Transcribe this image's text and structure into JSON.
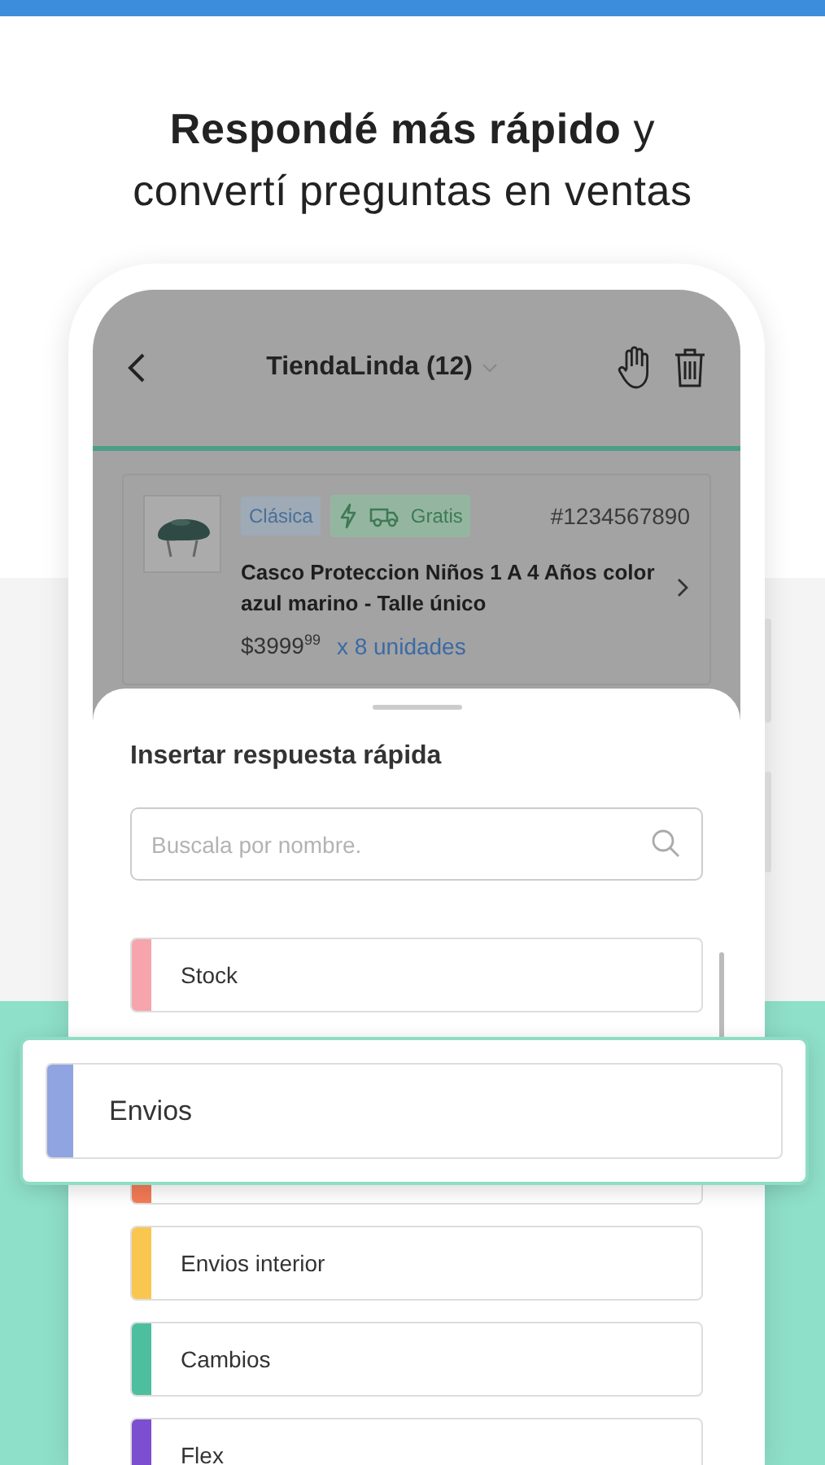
{
  "headline": [
    "**Respondé más rápido** y",
    "convertí preguntas en ventas"
  ],
  "header": {
    "title": "TiendaLinda (12)"
  },
  "product": {
    "tags": [
      {
        "label": "Clásica",
        "kind": "listing"
      },
      {
        "label": "Gratis",
        "kind": "shipping"
      }
    ],
    "code": "#1234567890",
    "title": "Casco Proteccion Niños 1 A 4 Años color azul marino - Talle único",
    "price": "$3999$^{99}$",
    "quantity": "x 8 unidades"
  },
  "sheet": {
    "title": "Insertar respuesta rápida",
    "search": {
      "placeholder": "Buscala por nombre."
    },
    "items": [
      {
        "label": "Stock",
        "color": "#f6a5ad",
        "dragged": false
      },
      {
        "label": "Envios",
        "color": "#8fa4e0",
        "dragged": true
      },
      {
        "color": "#f47a55",
        "dragged": false
      },
      {
        "label": "Envios interior",
        "color": "#f9c74f",
        "dragged": false
      },
      {
        "label": "Cambios",
        "color": "#4dbf9f",
        "dragged": false
      },
      {
        "label": "Flex",
        "color": "#7b4fcf",
        "dragged": false
      }
    ]
  }
}
